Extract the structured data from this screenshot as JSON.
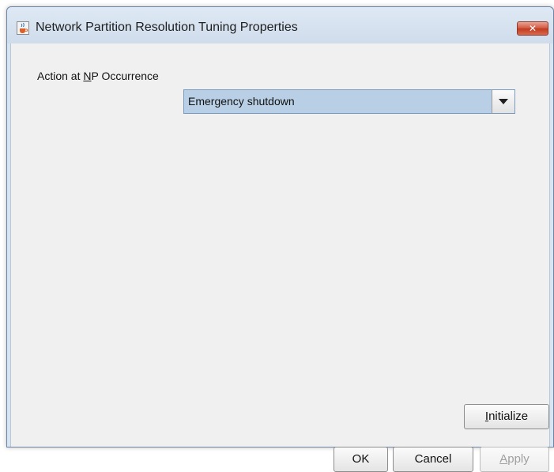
{
  "window": {
    "title": "Network Partition Resolution Tuning Properties",
    "close_glyph": "✕",
    "icon": "java-cup-icon"
  },
  "form": {
    "np_action_label_prefix": "Action at ",
    "np_action_label_mnemonic": "N",
    "np_action_label_suffix": "P Occurrence",
    "np_action_value": "Emergency shutdown",
    "dropdown_icon": "chevron-down-icon"
  },
  "buttons": {
    "initialize_mnemonic": "I",
    "initialize_rest": "nitialize",
    "ok": "OK",
    "cancel": "Cancel",
    "apply_mnemonic": "A",
    "apply_rest": "pply",
    "apply_enabled": false
  },
  "colors": {
    "selection_fill": "#b8cfe6",
    "window_frame": "#d7e4f2",
    "close_button": "#c13a20"
  }
}
